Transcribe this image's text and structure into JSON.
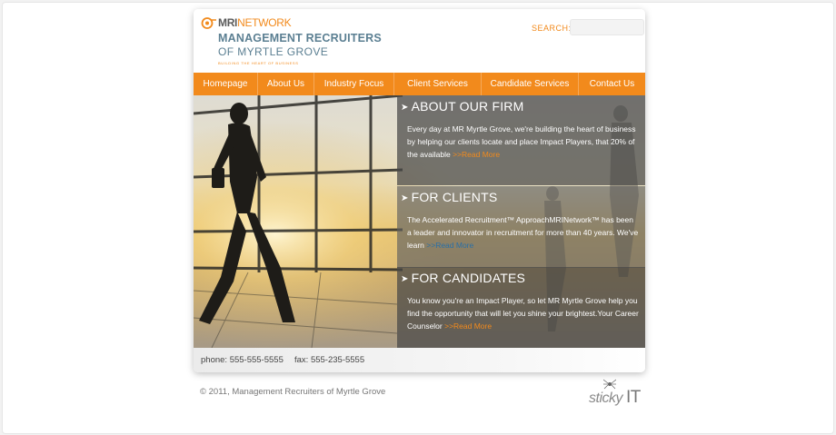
{
  "logo": {
    "mri": "MRI",
    "network": "NETWORK",
    "line1": "MANAGEMENT RECRUITERS",
    "line2": "OF MYRTLE GROVE",
    "tagline": "BUILDING THE HEART OF BUSINESS"
  },
  "search": {
    "label": "SEARCH:",
    "value": "",
    "placeholder": ""
  },
  "nav": {
    "items": [
      {
        "label": "Homepage"
      },
      {
        "label": "About Us"
      },
      {
        "label": "Industry Focus"
      },
      {
        "label": "Client Services"
      },
      {
        "label": "Candidate Services"
      },
      {
        "label": "Contact Us"
      }
    ]
  },
  "panels": [
    {
      "title": "ABOUT OUR FIRM",
      "text": "Every day at MR Myrtle Grove, we're building the heart of business by helping our clients locate and place Impact Players, that 20% of the available ",
      "link": ">>Read More"
    },
    {
      "title": "FOR CLIENTS",
      "text": "The Accelerated Recruitment™ ApproachMRINetwork™ has been a leader and innovator in recruitment for more than 40 years. We've learn ",
      "link": ">>Read More"
    },
    {
      "title": "FOR CANDIDATES",
      "text": "You know you're an Impact Player, so let MR Myrtle Grove help you find the opportunity that will let you shine your brightest.Your Career Counselor ",
      "link": ">>Read More"
    }
  ],
  "contact": {
    "phone": "phone: 555-555-5555",
    "fax": "fax: 555-235-5555"
  },
  "footer": {
    "copyright": "© 2011, Management Recruiters of Myrtle Grove",
    "credit_script": "sticky",
    "credit_it": "IT"
  },
  "colors": {
    "accent": "#f28a1c",
    "nav_bg": "#f28a1c",
    "logo_blue": "#5b7f92",
    "panel_bg": "#464646"
  },
  "icons": {
    "panel_arrow": "chevron-right-icon",
    "logo": "mri-logo-mark"
  }
}
